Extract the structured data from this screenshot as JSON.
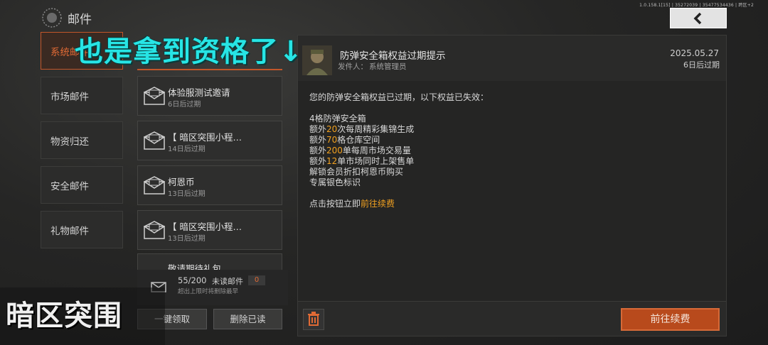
{
  "header": {
    "title": "邮件",
    "version": "1.0.158.1[15] | 35272039 | 35477534436 | 跨区+2",
    "back_icon": "chevron-left-icon"
  },
  "overlay_caption": "也是拿到资格了↓",
  "categories": [
    {
      "label": "系统邮件",
      "active": true
    },
    {
      "label": "市场邮件",
      "active": false
    },
    {
      "label": "物资归还",
      "active": false
    },
    {
      "label": "安全邮件",
      "active": false
    },
    {
      "label": "礼物邮件",
      "active": false
    }
  ],
  "mail_list": [
    {
      "title": "体验服测试邀请",
      "sub": "6日后过期"
    },
    {
      "title": "【 暗区突围小程…",
      "sub": "14日后过期"
    },
    {
      "title": "柯恩币",
      "sub": "13日后过期"
    },
    {
      "title": "【 暗区突围小程…",
      "sub": "13日后过期"
    }
  ],
  "mail_partial_title": "敬请期待礼包",
  "footer": {
    "count": "55/200",
    "unread_label": "未读邮件",
    "unread_count": "0",
    "warning": "超出上限时将删除最早",
    "claim_all": "一键领取",
    "delete_read": "删除已读"
  },
  "detail": {
    "title": "防弹安全箱权益过期提示",
    "sender_label": "发件人：",
    "sender": "系统管理员",
    "date": "2025.05.27",
    "expire": "6日后过期",
    "intro": "您的防弹安全箱权益已过期，以下权益已失效：",
    "items": [
      {
        "pre": "4格防弹安全箱",
        "num": "",
        "post": ""
      },
      {
        "pre": "额外",
        "num": "20",
        "post": "次每周精彩集锦生成"
      },
      {
        "pre": "额外",
        "num": "70",
        "post": "格仓库空间"
      },
      {
        "pre": "额外",
        "num": "200",
        "post": "单每周市场交易量"
      },
      {
        "pre": "额外",
        "num": "12",
        "post": "单市场同时上架售单"
      },
      {
        "pre": "解锁会员折扣柯恩币购买",
        "num": "",
        "post": ""
      },
      {
        "pre": "专属银色标识",
        "num": "",
        "post": ""
      }
    ],
    "cta_pre": "点击按钮立即",
    "cta_link": "前往续费",
    "renew_button": "前往续费",
    "trash_icon": "trash-icon"
  },
  "game_logo": "暗区突围",
  "colors": {
    "accent": "#c2562a",
    "highlight": "#f0a020",
    "caption": "#27e5e5"
  }
}
